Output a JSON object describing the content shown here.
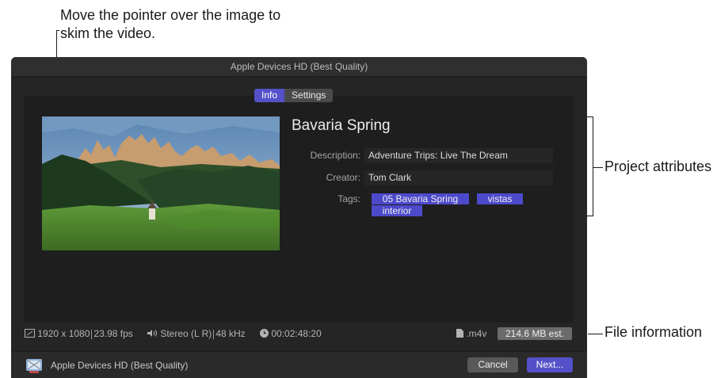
{
  "callouts": {
    "top": "Move the pointer over the image to skim the video.",
    "project": "Project attributes",
    "file": "File information"
  },
  "window": {
    "title": "Apple Devices HD (Best Quality)"
  },
  "tabs": [
    {
      "label": "Info",
      "active": true
    },
    {
      "label": "Settings",
      "active": false
    }
  ],
  "project": {
    "title": "Bavaria Spring",
    "description_label": "Description:",
    "description_value": "Adventure Trips: Live The Dream",
    "creator_label": "Creator:",
    "creator_value": "Tom Clark",
    "tags_label": "Tags:",
    "tags": [
      "05 Bavaria Spring",
      "vistas",
      "interior"
    ]
  },
  "file_info": {
    "resolution": "1920 x 1080",
    "frame_rate": "23.98 fps",
    "audio": "Stereo (L R)",
    "sample_rate": "48 kHz",
    "duration": "00:02:48:20",
    "extension": ".m4v",
    "size": "214.6 MB est."
  },
  "footer": {
    "preset_label": "Apple Devices HD (Best Quality)",
    "cancel_label": "Cancel",
    "next_label": "Next..."
  },
  "icons": {
    "screen": "screen-size-icon",
    "speaker": "speaker-icon",
    "clock": "clock-icon",
    "file": "file-icon",
    "preset": "apple-devices-preset-icon"
  },
  "colors": {
    "accent": "#5451c9",
    "window_bg": "#252525",
    "panel_bg": "#1e1e1e"
  }
}
